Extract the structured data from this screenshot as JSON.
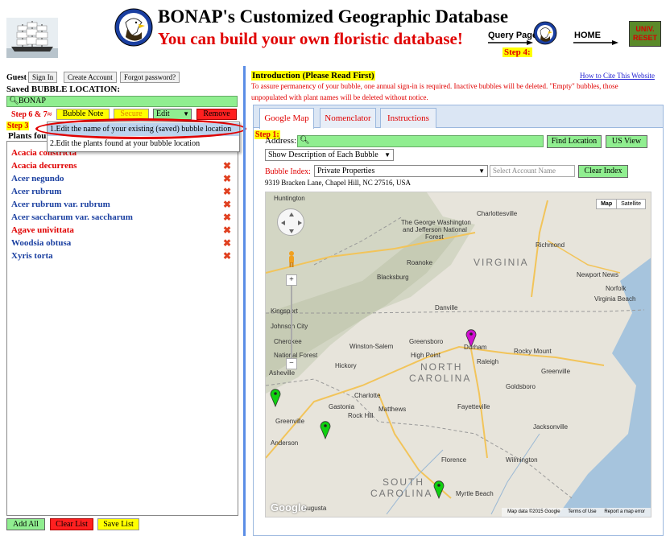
{
  "header": {
    "title": "BONAP's Customized Geographic Database",
    "subtitle": "You can build your own floristic database!",
    "query_page_label": "Query Page",
    "home_label": "HOME",
    "univ_reset_label": "UNIV. RESET",
    "step4_label": "Step 4:"
  },
  "left": {
    "guest_label": "Guest",
    "sign_in_label": "Sign In",
    "create_account_label": "Create Account",
    "forgot_password_label": "Forgot password?",
    "saved_bubble_label": "Saved BUBBLE LOCATION:",
    "bubble_value": "BONAP",
    "step67_label": "Step 6 & 7",
    "bubble_note_label": "Bubble Note",
    "secure_label": "Secure",
    "edit_label": "Edit",
    "remove_label": "Remove",
    "step3_label": "Step 3",
    "plants_found_label": "Plants found",
    "edit_options": [
      "1.Edit the name of your existing (saved) bubble location",
      "2.Edit the plants found at your bubble location"
    ],
    "plants": [
      {
        "name": "Acacia constricta",
        "color": "red"
      },
      {
        "name": "Acacia decurrens",
        "color": "red"
      },
      {
        "name": "Acer negundo",
        "color": "blue"
      },
      {
        "name": "Acer rubrum",
        "color": "blue"
      },
      {
        "name": "Acer rubrum var. rubrum",
        "color": "blue"
      },
      {
        "name": "Acer saccharum var. saccharum",
        "color": "blue"
      },
      {
        "name": "Agave univittata",
        "color": "red"
      },
      {
        "name": "Woodsia obtusa",
        "color": "blue"
      },
      {
        "name": "Xyris torta",
        "color": "blue"
      }
    ],
    "add_all_label": "Add All",
    "clear_list_label": "Clear List",
    "save_list_label": "Save List"
  },
  "right": {
    "intro_heading": "Introduction (Please Read First)",
    "cite_link": "How to Cite This Website",
    "intro_text": "To assure permanency of your bubble, one annual sign-in is required. Inactive bubbles will be deleted. \"Empty\" bubbles, those unpopulated with plant names will be deleted without notice.",
    "tabs": [
      "Google Map",
      "Nomenclator",
      "Instructions"
    ],
    "step1_label": "Step 1:",
    "address_label": "Address:",
    "find_location_label": "Find Location",
    "us_view_label": "US View",
    "show_description_label": "Show Description of Each Bubble",
    "bubble_index_label": "Bubble Index:",
    "bubble_index_value": "Private Properties",
    "select_account_placeholder": "Select Account Name",
    "clear_index_label": "Clear Index",
    "address_line": "9319 Bracken Lane, Chapel Hill, NC 27516, USA"
  },
  "map": {
    "type_map": "Map",
    "type_satellite": "Satellite",
    "google_logo": "Google",
    "footer_data": "Map data ©2015 Google",
    "footer_terms": "Terms of Use",
    "footer_report": "Report a map error",
    "state_labels": {
      "virginia": "VIRGINIA",
      "north_carolina_1": "NORTH",
      "north_carolina_2": "CAROLINA",
      "south_carolina_1": "SOUTH",
      "south_carolina_2": "CAROLINA"
    },
    "places": {
      "huntington": "Huntington",
      "charlottesville": "Charlottesville",
      "gw_forest_1": "The George Washington",
      "gw_forest_2": "and Jefferson National",
      "gw_forest_3": "Forest",
      "richmond": "Richmond",
      "roanoke": "Roanoke",
      "blacksburg": "Blacksburg",
      "newport_news": "Newport News",
      "norfolk": "Norfolk",
      "virginia_beach": "Virginia Beach",
      "kingsport": "Kingsport",
      "danville": "Danville",
      "johnson_city": "Johnson City",
      "cherokee_1": "Cherokee",
      "cherokee_2": "National Forest",
      "winston_salem": "Winston-Salem",
      "greensboro": "Greensboro",
      "durham": "Durham",
      "high_point": "High Point",
      "raleigh": "Raleigh",
      "rocky_mount": "Rocky Mount",
      "greenville_nc": "Greenville",
      "asheville": "Asheville",
      "hickory": "Hickory",
      "goldsboro": "Goldsboro",
      "charlotte": "Charlotte",
      "gastonia": "Gastonia",
      "fayetteville": "Fayetteville",
      "greenville_sc": "Greenville",
      "rock_hill": "Rock Hill",
      "matthews": "Matthews",
      "jacksonville": "Jacksonville",
      "anderson": "Anderson",
      "florence": "Florence",
      "wilmington": "Wilmington",
      "myrtle_beach": "Myrtle Beach",
      "augusta": "Augusta"
    },
    "pins": [
      {
        "color": "#d010d0",
        "lat": 35.99,
        "lon": -78.95
      },
      {
        "color": "#10d010",
        "lat": 35.05,
        "lon": -82.9
      },
      {
        "color": "#10d010",
        "lat": 34.55,
        "lon": -81.9
      },
      {
        "color": "#10d010",
        "lat": 33.6,
        "lon": -79.6
      }
    ]
  }
}
